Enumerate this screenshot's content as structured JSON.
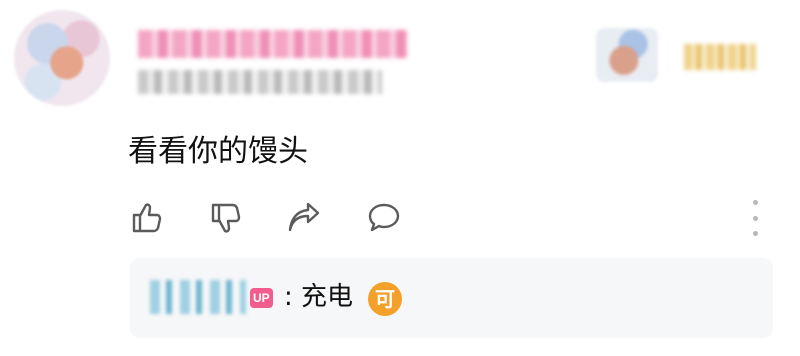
{
  "comment": {
    "author_name": "",
    "meta_text": "",
    "badge_text": "",
    "text": "看看你的馒头"
  },
  "actions": {
    "like_icon": "thumbs-up-icon",
    "dislike_icon": "thumbs-down-icon",
    "share_icon": "share-arrow-icon",
    "reply_icon": "speech-bubble-icon",
    "more_icon": "more-vertical-icon"
  },
  "reply": {
    "author_name": "",
    "up_badge": "UP",
    "text": ": 充电",
    "emoji_label": "可"
  },
  "colors": {
    "up_badge": "#f25d8e",
    "emoji": "#f4a12b",
    "reply_bg": "#f6f7f8",
    "icon_stroke": "#5b5b5b"
  }
}
